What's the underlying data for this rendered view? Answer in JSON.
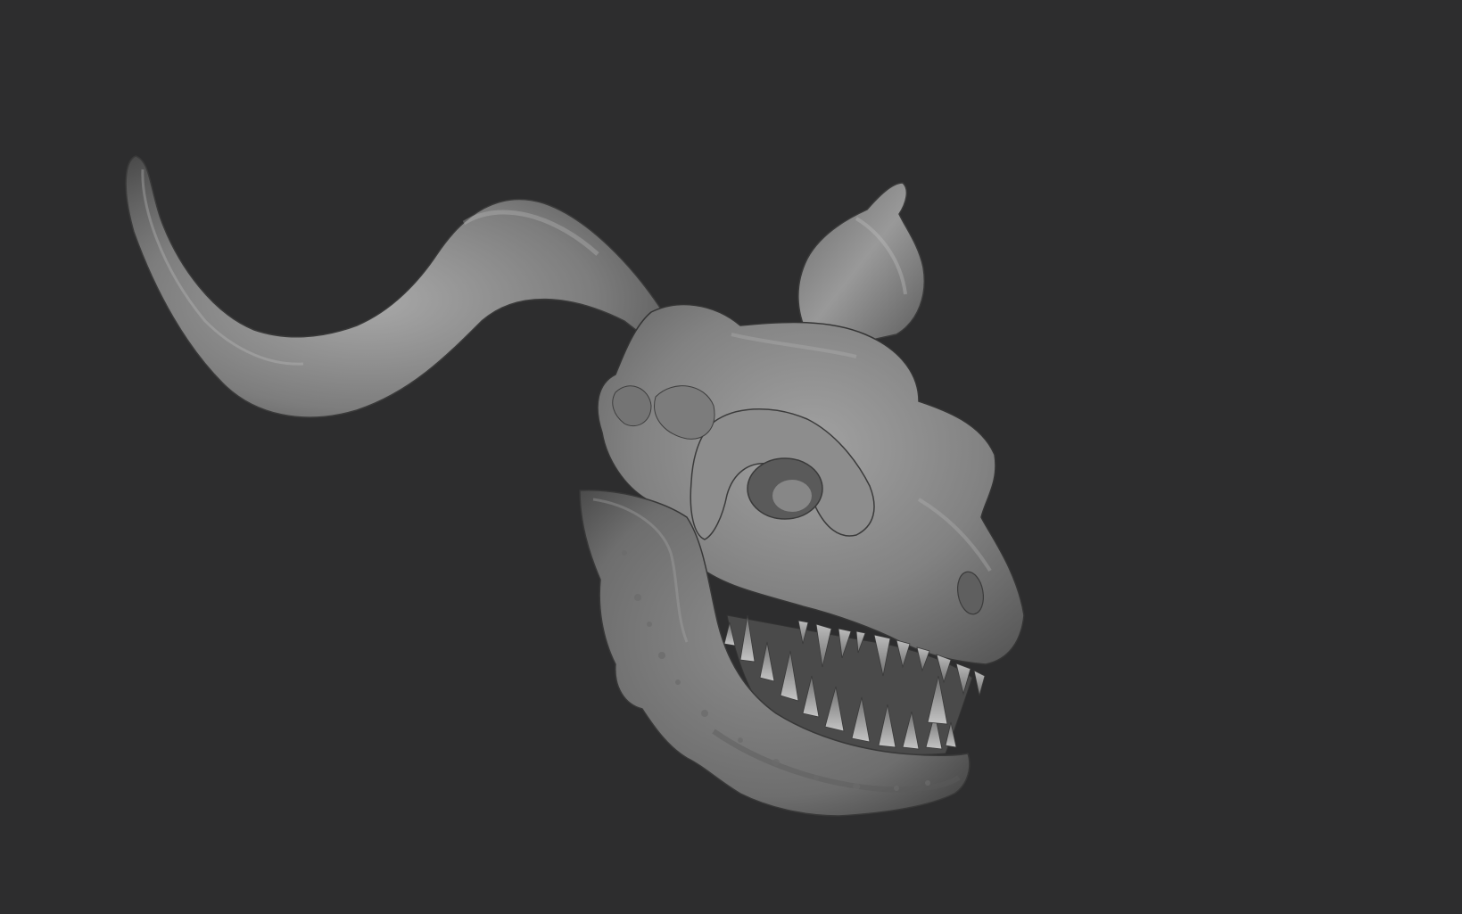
{
  "viewport": {
    "background_color": "#2d2d2e",
    "model_base_color": "#8a8a8a",
    "model_shadow_color": "#3e3e3e",
    "model_highlight_color": "#c8c8c8"
  }
}
